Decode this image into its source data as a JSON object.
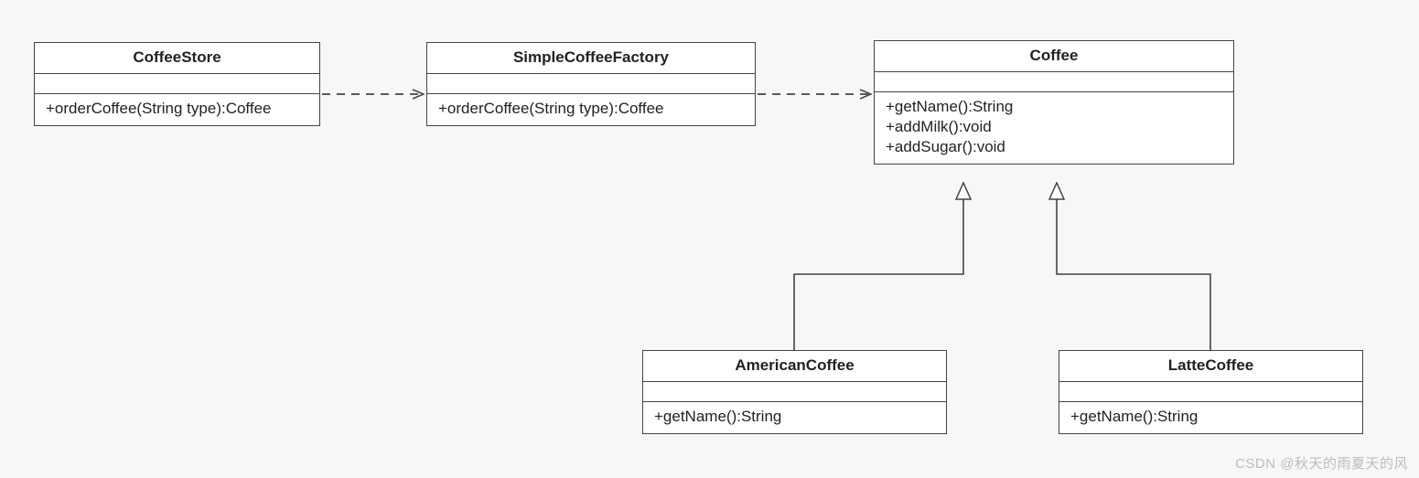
{
  "classes": {
    "coffeeStore": {
      "name": "CoffeeStore",
      "operations": [
        "+orderCoffee(String type):Coffee"
      ]
    },
    "simpleCoffeeFactory": {
      "name": "SimpleCoffeeFactory",
      "operations": [
        "+orderCoffee(String type):Coffee"
      ]
    },
    "coffee": {
      "name": "Coffee",
      "operations": [
        "+getName():String",
        "+addMilk():void",
        "+addSugar():void"
      ]
    },
    "americanCoffee": {
      "name": "AmericanCoffee",
      "operations": [
        "+getName():String"
      ]
    },
    "latteCoffee": {
      "name": "LatteCoffee",
      "operations": [
        "+getName():String"
      ]
    }
  },
  "relationships": [
    {
      "from": "CoffeeStore",
      "to": "SimpleCoffeeFactory",
      "type": "dependency"
    },
    {
      "from": "SimpleCoffeeFactory",
      "to": "Coffee",
      "type": "dependency"
    },
    {
      "from": "AmericanCoffee",
      "to": "Coffee",
      "type": "generalization"
    },
    {
      "from": "LatteCoffee",
      "to": "Coffee",
      "type": "generalization"
    }
  ],
  "watermark": "CSDN @秋天的雨夏天的风"
}
